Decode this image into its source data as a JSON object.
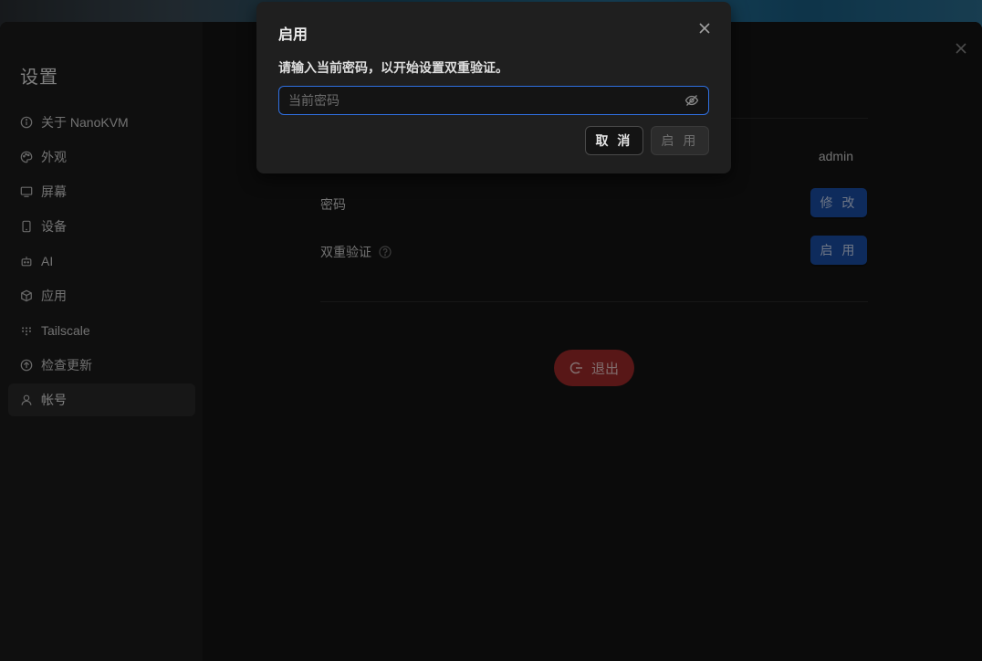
{
  "sidebar": {
    "title": "设置",
    "items": [
      {
        "label": "关于 NanoKVM",
        "icon": "info-icon"
      },
      {
        "label": "外观",
        "icon": "palette-icon"
      },
      {
        "label": "屏幕",
        "icon": "monitor-icon"
      },
      {
        "label": "设备",
        "icon": "phone-icon"
      },
      {
        "label": "AI",
        "icon": "robot-icon"
      },
      {
        "label": "应用",
        "icon": "box-icon"
      },
      {
        "label": "Tailscale",
        "icon": "tailscale-icon"
      },
      {
        "label": "检查更新",
        "icon": "arrow-up-circle-icon"
      },
      {
        "label": "帐号",
        "icon": "user-icon",
        "active": true
      }
    ]
  },
  "account": {
    "username_value": "admin",
    "password_label": "密码",
    "password_button": "修 改",
    "twofa_label": "双重验证",
    "twofa_button": "启 用",
    "logout_label": "退出"
  },
  "modal": {
    "title": "启用",
    "description": "请输入当前密码，以开始设置双重验证。",
    "password_placeholder": "当前密码",
    "password_value": "",
    "cancel_label": "取 消",
    "enable_label": "启 用"
  },
  "colors": {
    "primary": "#1a4fa8",
    "danger": "#a02a2a",
    "focus": "#2f6fe0"
  }
}
